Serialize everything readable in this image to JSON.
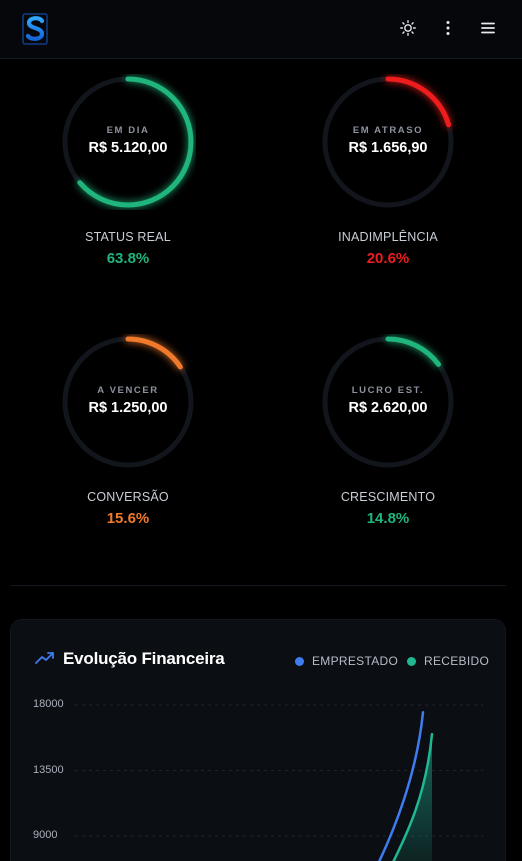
{
  "header": {
    "logo_icon": "dollar-s-logo-icon",
    "buttons": [
      {
        "name": "theme-toggle-button",
        "icon": "sun-icon"
      },
      {
        "name": "more-options-button",
        "icon": "vertical-dots-icon"
      },
      {
        "name": "menu-button",
        "icon": "hamburger-menu-icon"
      }
    ]
  },
  "gauges": [
    {
      "ring_label": "EM DIA",
      "amount": "R$ 5.120,00",
      "metric_label": "STATUS REAL",
      "percent_text": "63.8%",
      "percent": 63.8,
      "color": "#1fb57c"
    },
    {
      "ring_label": "EM ATRASO",
      "amount": "R$ 1.656,90",
      "metric_label": "INADIMPLÊNCIA",
      "percent_text": "20.6%",
      "percent": 20.6,
      "color": "#ee1c1c"
    },
    {
      "ring_label": "A VENCER",
      "amount": "R$ 1.250,00",
      "metric_label": "CONVERSÃO",
      "percent_text": "15.6%",
      "percent": 15.6,
      "color": "#f07a2a"
    },
    {
      "ring_label": "LUCRO EST.",
      "amount": "R$ 2.620,00",
      "metric_label": "CRESCIMENTO",
      "percent_text": "14.8%",
      "percent": 14.8,
      "color": "#1fb57c"
    }
  ],
  "chart_card": {
    "title": "Evolução Financeira",
    "title_icon": "trending-up-icon",
    "legend": [
      {
        "label": "EMPRESTADO",
        "color": "#3f7cf0"
      },
      {
        "label": "RECEBIDO",
        "color": "#1fb893"
      }
    ]
  },
  "chart_data": {
    "type": "area",
    "title": "Evolução Financeira",
    "y_ticks": [
      "18000",
      "13500",
      "9000"
    ],
    "ylim_visible": [
      9000,
      18000
    ],
    "series": [
      {
        "name": "EMPRESTADO",
        "end_value": 17500
      },
      {
        "name": "RECEBIDO",
        "end_value": 16000
      }
    ]
  }
}
